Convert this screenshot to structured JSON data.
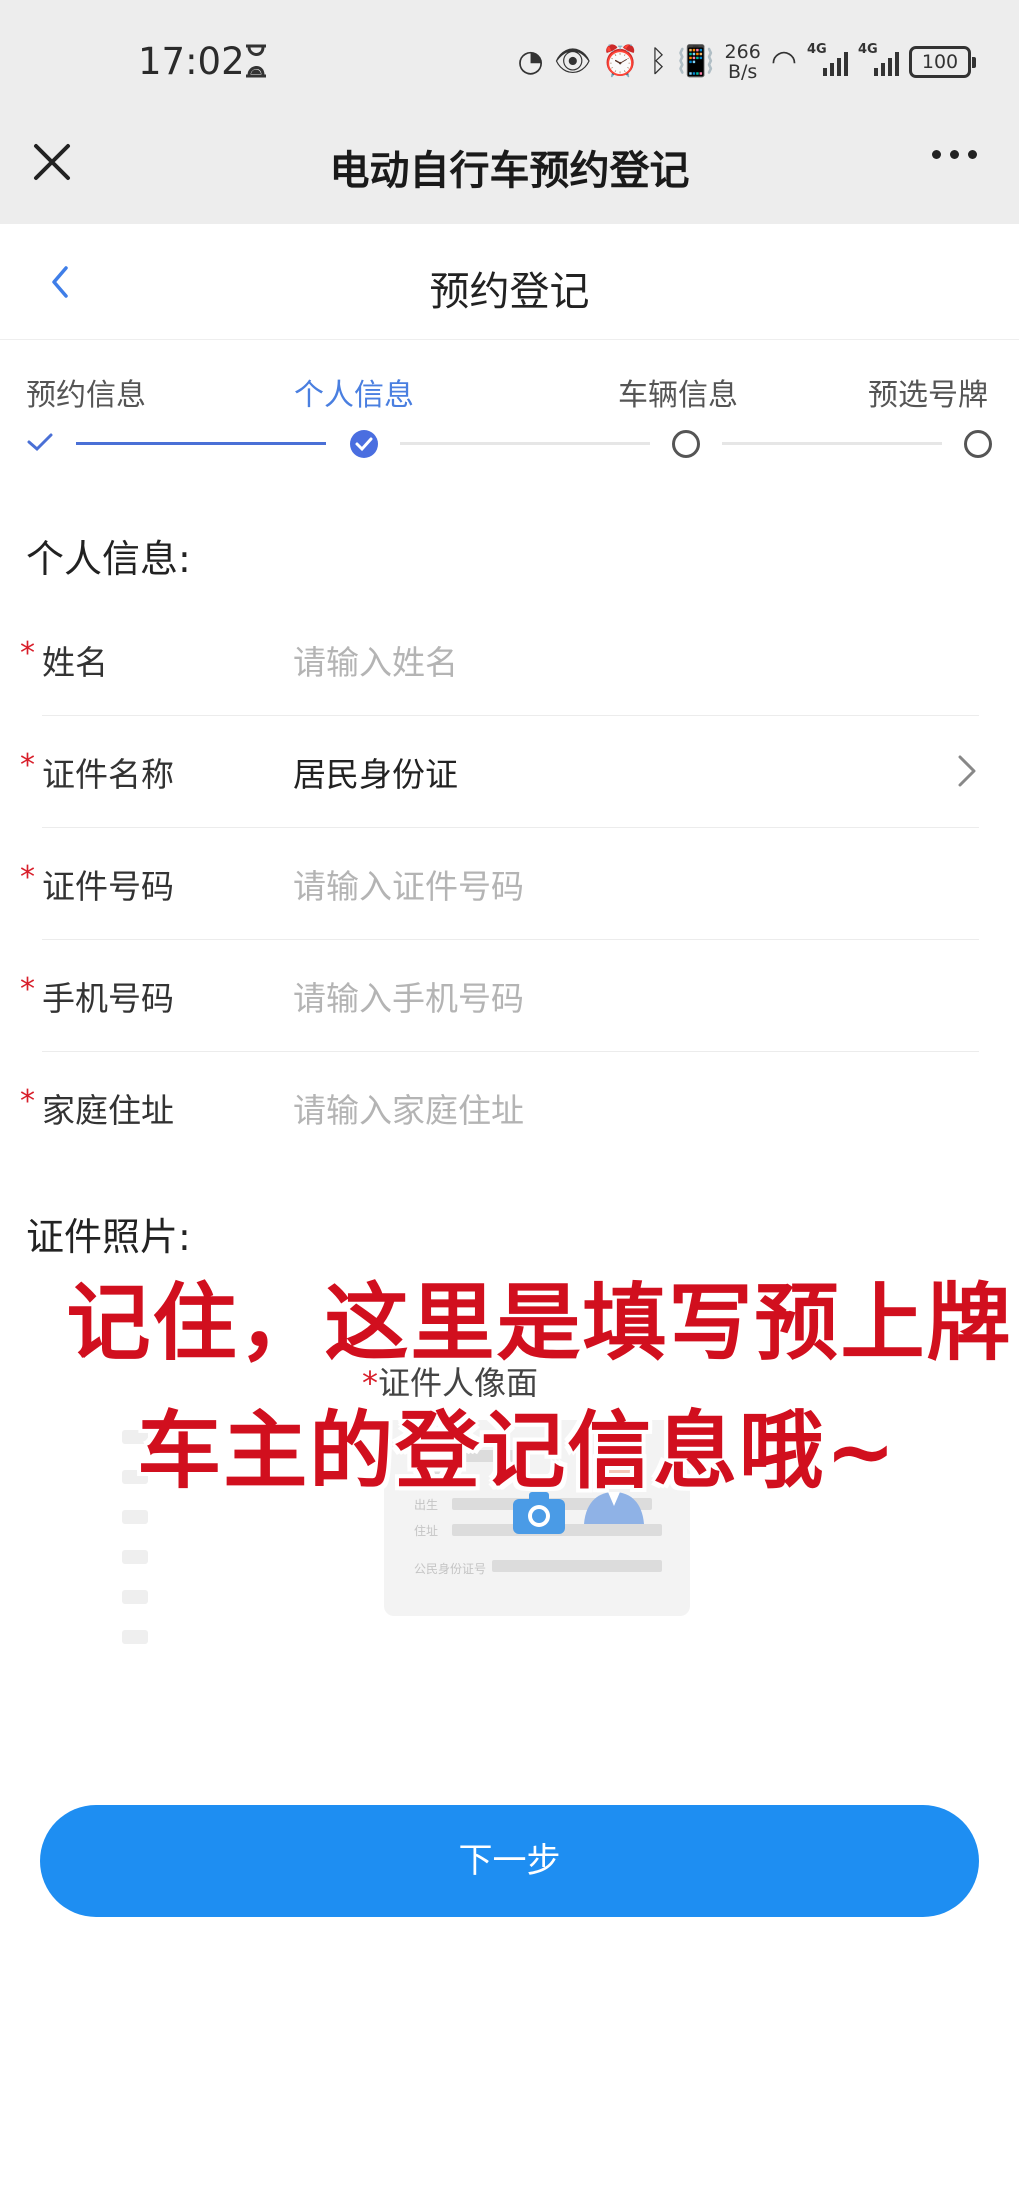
{
  "status_bar": {
    "time": "17:02",
    "speed_value": "266",
    "speed_unit": "B/s",
    "network_1": "4G",
    "network_2": "4G",
    "battery": "100"
  },
  "titlebar": {
    "title": "电动自行车预约登记"
  },
  "page_header": {
    "title": "预约登记"
  },
  "steps": [
    {
      "label": "预约信息",
      "state": "done"
    },
    {
      "label": "个人信息",
      "state": "current"
    },
    {
      "label": "车辆信息",
      "state": "pending"
    },
    {
      "label": "预选号牌",
      "state": "pending"
    }
  ],
  "personal_section": {
    "title": "个人信息:",
    "fields": [
      {
        "required_mark": "*",
        "label": "姓名",
        "placeholder": "请输入姓名",
        "value": ""
      },
      {
        "required_mark": "*",
        "label": "证件名称",
        "placeholder": "",
        "value": "居民身份证"
      },
      {
        "required_mark": "*",
        "label": "证件号码",
        "placeholder": "请输入证件号码",
        "value": ""
      },
      {
        "required_mark": "*",
        "label": "手机号码",
        "placeholder": "请输入手机号码",
        "value": ""
      },
      {
        "required_mark": "*",
        "label": "家庭住址",
        "placeholder": "请输入家庭住址",
        "value": ""
      }
    ]
  },
  "photo_section": {
    "title": "证件照片:",
    "upload_required_mark": "*",
    "upload_label": "证件人像面",
    "card_labels": [
      "出生",
      "住址",
      "公民身份证号"
    ]
  },
  "overlay_text": {
    "line1": "记住，这里是填写预上牌",
    "line2": "车主的登记信息哦~"
  },
  "next_button": {
    "label": "下一步"
  },
  "colors": {
    "accent": "#1e8ef2",
    "step_active": "#4a6ee0",
    "required": "#d81e2a",
    "overlay_red": "#d10f1e"
  }
}
